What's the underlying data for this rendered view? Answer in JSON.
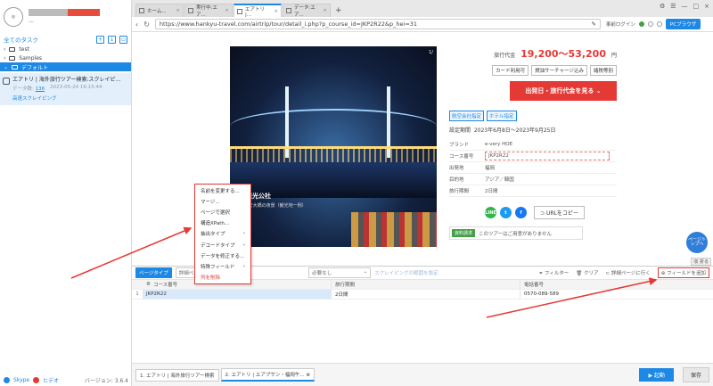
{
  "sidebar": {
    "all_tasks": "全てのタスク",
    "tree": [
      {
        "label": "test"
      },
      {
        "label": "Samples"
      },
      {
        "label": "デフォルト"
      }
    ],
    "task": {
      "title": "エアトリ | 海外旅行ツアー検索:スクレイピ...",
      "data_count_label": "データ数:",
      "data_count": "136",
      "date": "2023-05-24 16:15:44",
      "link": "高速スクレイピング"
    },
    "bottom": {
      "skype": "Skype",
      "help": "ヒデオ",
      "version": "バージョン: 3.6.4"
    }
  },
  "browser": {
    "tabs": [
      {
        "label": "ホーム..."
      },
      {
        "label": "実行中:エア..."
      },
      {
        "label": "エアトリ |..."
      },
      {
        "label": "データ:エア..."
      }
    ],
    "url": "https://www.hankyu-travel.com/airtrip/tour/detail_i.php?p_course_id=JKP2R22&p_hei=31",
    "login": "事前ログイン",
    "pc_browser": "PCブラウザ"
  },
  "page": {
    "photo_counter": "1/",
    "caption_title": "韓国観光公社",
    "caption_sub": "ポル 広安大橋の夜景（観光地一例）",
    "price_label": "旅行代金",
    "price": "19,200〜53,200",
    "price_unit": "円",
    "chips": [
      "カード利用可",
      "燃油サーチャージ込み",
      "諸税等別"
    ],
    "red_button": "出発日・旅行代金を見る",
    "badges": [
      "航空会社指定",
      "ホテル指定"
    ],
    "period_label": "設定期間",
    "period": "2023年6月8日〜2023年9月25日",
    "details": [
      {
        "k": "ブランド",
        "v": "e-very HOE"
      },
      {
        "k": "コース番号",
        "v": "JKP2R22"
      },
      {
        "k": "出発地",
        "v": "福岡"
      },
      {
        "k": "目的地",
        "v": "アジア／韓国"
      },
      {
        "k": "旅行期間",
        "v": "2日間"
      }
    ],
    "social": {
      "line": "LINE",
      "twitter": "t",
      "facebook": "f"
    },
    "url_copy": "URLをコピー",
    "notice_badge": "資料請求",
    "notice_text": "このツアーはご用意がありません",
    "page_top": "ページトップへ",
    "collapse": "収 折る"
  },
  "context_menu": [
    {
      "label": "名前を変更する..."
    },
    {
      "label": "マージ..."
    },
    {
      "label": "ページで選択"
    },
    {
      "label": "構造XPath..."
    },
    {
      "label": "抽出タイプ"
    },
    {
      "label": "デコードタイプ"
    },
    {
      "label": "データを修正する..."
    },
    {
      "label": "特殊フィールド"
    },
    {
      "label": "列を削除"
    }
  ],
  "panel": {
    "tab": "ページタイプ",
    "select1": "詳細ページ",
    "select2": "必要なし",
    "scroll_link": "スクレイピングの範囲を設定",
    "filter": "フィルター",
    "clear": "クリア",
    "goto_detail": "詳細ページに行く",
    "add_field": "フィールドを追加",
    "columns": [
      "コース番号",
      "旅行期間",
      "電話番号"
    ],
    "rows": [
      {
        "n": "1",
        "c1": "JKP2R22",
        "c2": "2日間",
        "c3": "0570-089-589"
      }
    ]
  },
  "bottom": {
    "tabs": [
      "1. エアトリ | 海外旅行ツアー検索",
      "2. エアトリ | エアプサン・福岡午..."
    ],
    "start": "▶ 起動",
    "save": "保存"
  },
  "colors": {
    "accent": "#1e88e5",
    "price": "#e53935",
    "annotation": "#e53935"
  }
}
